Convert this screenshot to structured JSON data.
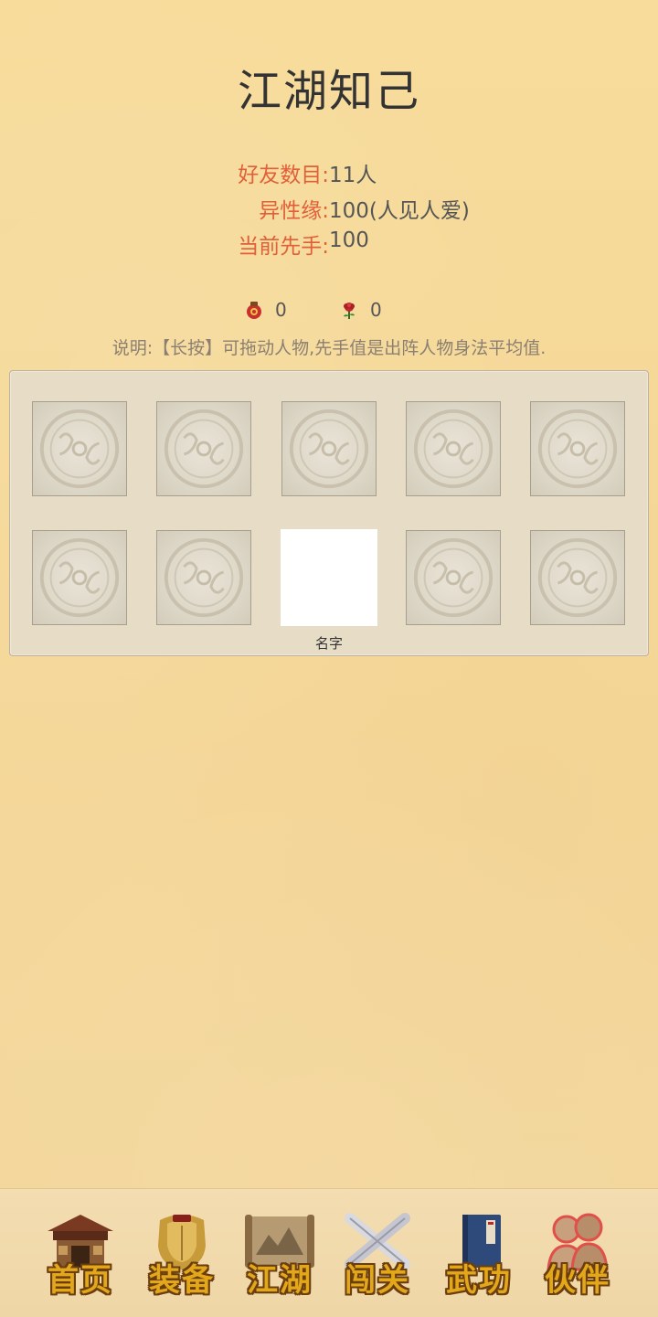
{
  "title": "江湖知己",
  "stats": [
    {
      "label": "好友数目:",
      "value": "11人"
    },
    {
      "label": "异性缘:",
      "value": "100(人见人爱)"
    },
    {
      "label": "当前先手:",
      "value": "100"
    }
  ],
  "items": [
    {
      "icon": "wine-jar-icon",
      "count": "0"
    },
    {
      "icon": "rose-icon",
      "count": "0"
    }
  ],
  "note": "说明:【长按】可拖动人物,先手值是出阵人物身法平均值.",
  "formation": {
    "selected_name": "名字"
  },
  "nav": [
    {
      "label": "首页",
      "icon": "house-icon"
    },
    {
      "label": "装备",
      "icon": "armor-icon"
    },
    {
      "label": "江湖",
      "icon": "scroll-map-icon"
    },
    {
      "label": "闯关",
      "icon": "crossed-swords-icon"
    },
    {
      "label": "武功",
      "icon": "manual-book-icon"
    },
    {
      "label": "伙伴",
      "icon": "companions-icon",
      "active": true
    }
  ],
  "colors": {
    "accent_label": "#e0603a",
    "nav_label": "#e3a81a"
  }
}
